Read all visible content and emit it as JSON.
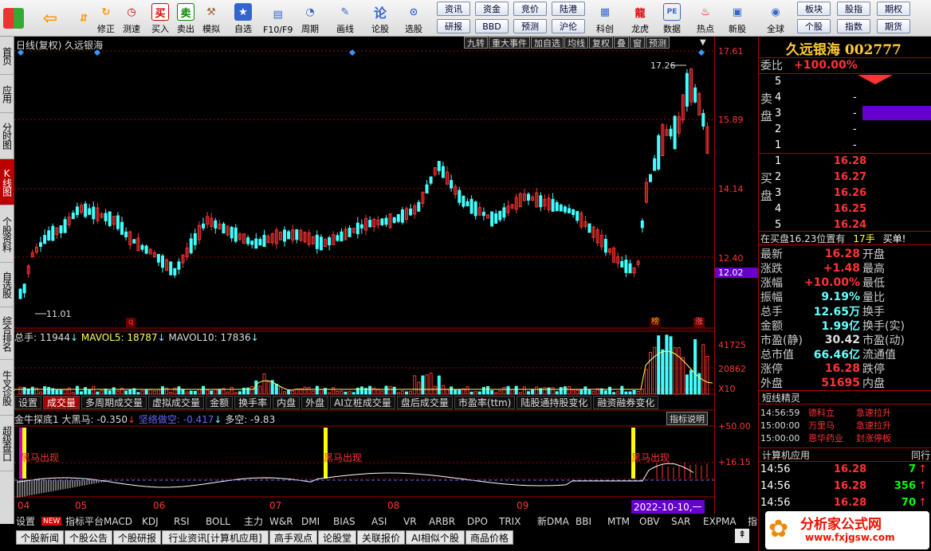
{
  "toolbar": {
    "items": [
      {
        "label": "",
        "icon": "windows-logo"
      },
      {
        "label": "",
        "icon": "back-arrow"
      },
      {
        "label": "",
        "icon": "up-down-arrow"
      },
      {
        "label": "修正",
        "icon": "wrench"
      },
      {
        "label": "测速",
        "icon": "clock"
      },
      {
        "label": "买入",
        "icon": "buy",
        "glyph": "买"
      },
      {
        "label": "卖出",
        "icon": "sell",
        "glyph": "卖"
      },
      {
        "label": "模拟",
        "icon": "hammer"
      },
      {
        "label": "自选",
        "icon": "star"
      },
      {
        "label": "F10/F9",
        "icon": "doc"
      },
      {
        "label": "周期",
        "icon": "cycle"
      },
      {
        "label": "画线",
        "icon": "pen"
      },
      {
        "label": "论股",
        "icon": "discuss",
        "glyph": "论"
      },
      {
        "label": "选股",
        "icon": "search"
      }
    ],
    "pills": [
      "资讯",
      "资金",
      "竞价",
      "陆港",
      "研报",
      "BBD",
      "预测",
      "沪伦"
    ],
    "items2": [
      {
        "label": "科创"
      },
      {
        "label": "龙虎"
      },
      {
        "label": "数据"
      },
      {
        "label": "热点"
      },
      {
        "label": "新股"
      },
      {
        "label": "全球"
      }
    ],
    "pills2": [
      "板块",
      "股指",
      "期权",
      "个股",
      "指数",
      "期货"
    ]
  },
  "lefttabs": [
    "首页",
    "应用",
    "分时图",
    "K线图",
    "个股资料",
    "自选股",
    "综合排名",
    "牛叉诊股",
    "超级盘口"
  ],
  "chart": {
    "header": "日线(复权) 久远银海",
    "tags": [
      "九转",
      "重大事件",
      "加自选",
      "均线",
      "复权",
      "叠",
      "窗",
      "预测"
    ],
    "price_axis": [
      "17.61",
      "15.89",
      "14.14",
      "12.40",
      "12.02"
    ],
    "hi_label": "17.26",
    "lo_label": "11.01",
    "badges": [
      "q",
      "榜",
      "涨"
    ],
    "vol_header": {
      "a": "总手: 11944",
      "b": "MAVOL5: 18787",
      "c": "MAVOL10: 17836"
    },
    "vol_axis": [
      "41725",
      "20862",
      "X10"
    ],
    "tabs": [
      "设置",
      "成交量",
      "多周期成交量",
      "虚拟成交量",
      "金额",
      "换手率",
      "内盘",
      "外盘",
      "AI立桩成交量",
      "盘后成交量",
      "市盈率(ttm)",
      "陆股通持股变化",
      "融资融券变化"
    ],
    "ind_header": {
      "a": "金牛探底1 大黑马: -0.350",
      "b": "坚络做空: -0.417",
      "c": "多空: -9.83"
    },
    "ind_btn": "指标说明",
    "ind_axis": [
      "+50.00",
      "+16.15"
    ],
    "signal_text": "黑马出现",
    "dates": [
      "04",
      "05",
      "06",
      "07",
      "08",
      "09"
    ],
    "date_box": "2022-10-10,一"
  },
  "bottom": {
    "row1": [
      "设置",
      "NEW",
      "指标平台",
      "MACD",
      "KDJ",
      "RSI",
      "BOLL",
      "主力",
      "W&R",
      "DMI",
      "BIAS",
      "ASI",
      "VR",
      "ARBR",
      "DPO",
      "TRIX",
      "新DMA",
      "BBI",
      "MTM",
      "OBV",
      "SAR",
      "EXPMA",
      "指"
    ],
    "row2": [
      "个股新闻",
      "个股公告",
      "个股研报",
      "行业资讯[计算机应用]",
      "高手观点",
      "论股堂",
      "关联报价",
      "AI相似个股",
      "商品价格"
    ]
  },
  "right": {
    "title": "久远银海 002777",
    "webi": {
      "label": "委比",
      "value": "+100.00%"
    },
    "sell": [
      {
        "n": "5",
        "p": "",
        "v": ""
      },
      {
        "n": "4",
        "p": "",
        "v": "-"
      },
      {
        "n": "3",
        "p": "",
        "v": "-"
      },
      {
        "n": "2",
        "p": "",
        "v": "-"
      },
      {
        "n": "1",
        "p": "",
        "v": "-"
      }
    ],
    "sell_label": "卖盘",
    "buy_label": "买盘",
    "buy": [
      {
        "n": "1",
        "p": "16.28"
      },
      {
        "n": "2",
        "p": "16.27"
      },
      {
        "n": "3",
        "p": "16.26"
      },
      {
        "n": "4",
        "p": "16.25"
      },
      {
        "n": "5",
        "p": "16.24"
      }
    ],
    "position": {
      "a": "在买盘16.23位置有",
      "b": "17手",
      "c": "买单!"
    },
    "stats": [
      [
        "最新",
        "16.28",
        "开盘",
        ""
      ],
      [
        "涨跌",
        "+1.48",
        "最高",
        ""
      ],
      [
        "涨幅",
        "+10.00%",
        "最低",
        ""
      ],
      [
        "振幅",
        "9.19%",
        "量比",
        ""
      ],
      [
        "总手",
        "12.65万",
        "换手",
        ""
      ],
      [
        "金额",
        "1.99亿",
        "换手(实)",
        ""
      ],
      [
        "市盈(静)",
        "30.42",
        "市盈(动)",
        ""
      ],
      [
        "总市值",
        "66.46亿",
        "流通值",
        ""
      ],
      [
        "涨停",
        "16.28",
        "跌停",
        ""
      ],
      [
        "外盘",
        "51695",
        "内盘",
        ""
      ]
    ],
    "elves_title": "短线精灵",
    "elves": [
      [
        "14:56:59",
        "德科立",
        "急速拉升"
      ],
      [
        "15:00:00",
        "万里马",
        "急速拉升"
      ],
      [
        "15:00:00",
        "恩华药业",
        "封涨停板"
      ]
    ],
    "sector": {
      "title": "计算机应用",
      "right": "同行"
    },
    "ticks": [
      [
        "14:56",
        "16.28",
        "7"
      ],
      [
        "14:56",
        "16.28",
        "356"
      ],
      [
        "14:56",
        "16.28",
        "70"
      ]
    ],
    "watermark": {
      "a": "分析家公式网",
      "b": "www.fxjgsw.com"
    }
  }
}
